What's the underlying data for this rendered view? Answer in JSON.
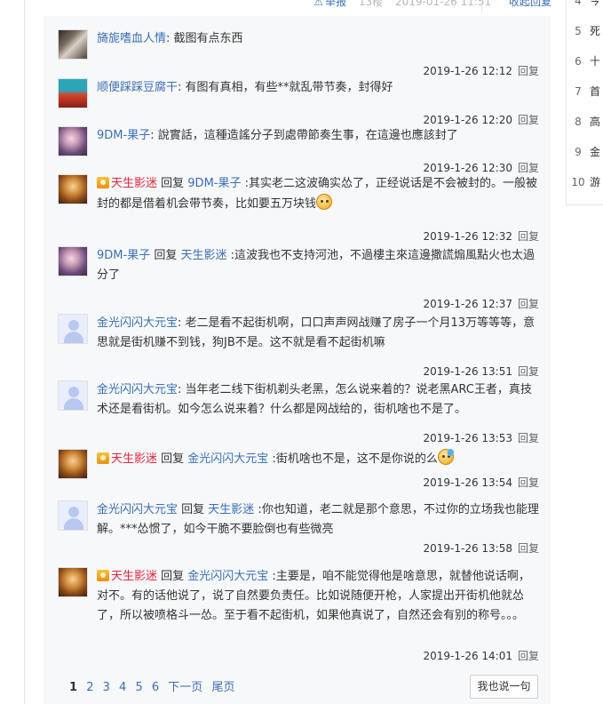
{
  "topbar": {
    "report_label": "举报",
    "floor": "13楼",
    "time": "2019-01-26 11:51",
    "collapse_label": "收起回复"
  },
  "replies": [
    {
      "author": "旖旎嗜血人情",
      "author_color": "#3a6fb4",
      "medal": false,
      "reply_to": "",
      "text": "截图有点东西",
      "time": "2019-1-26 12:12",
      "reply_label": "回复",
      "avatar": "av-1"
    },
    {
      "author": "顺便踩踩豆腐干",
      "author_color": "#3a6fb4",
      "medal": false,
      "reply_to": "",
      "text": "有图有真相，有些**就乱带节奏，封得好",
      "time": "2019-1-26 12:20",
      "reply_label": "回复",
      "avatar": "av-2"
    },
    {
      "author": "9DM-果子",
      "author_color": "#3a6fb4",
      "medal": false,
      "reply_to": "",
      "text": "說實話，這種造謠分子到處帶節奏生事，在這邊也應該封了",
      "time": "2019-1-26 12:30",
      "reply_label": "回复",
      "avatar": "av-3"
    },
    {
      "author": "天生影迷",
      "author_color": "#e0283c",
      "medal": true,
      "reply_to": "9DM-果子",
      "text": "其实老二这波确实怂了，正经说话是不会被封的。一般被封的都是借着机会带节奏，比如要五万块钱",
      "emoji": "smile",
      "time": "2019-1-26 12:32",
      "reply_label": "回复",
      "avatar": "av-4"
    },
    {
      "author": "9DM-果子",
      "author_color": "#3a6fb4",
      "medal": false,
      "reply_to": "天生影迷",
      "text": "這波我也不支持河池，不過樓主來這邊撒謊煽風點火也太過分了",
      "time": "2019-1-26 12:37",
      "reply_label": "回复",
      "avatar": "av-3"
    },
    {
      "author": "金光闪闪大元宝",
      "author_color": "#3a6fb4",
      "medal": false,
      "reply_to": "",
      "text": "老二是看不起街机啊，口口声声网战赚了房子一个月13万等等等，意思就是街机赚不到钱，狗JB不是。这不就是看不起街机嘛",
      "time": "2019-1-26 13:51",
      "reply_label": "回复",
      "avatar": "av-default"
    },
    {
      "author": "金光闪闪大元宝",
      "author_color": "#3a6fb4",
      "medal": false,
      "reply_to": "",
      "text": "当年老二线下街机剃头老黑，怎么说来着的？说老黑ARC王者，真技术还是看街机。如今怎么说来着？什么都是网战给的，街机啥也不是了。",
      "time": "2019-1-26 13:53",
      "reply_label": "回复",
      "avatar": "av-default"
    },
    {
      "author": "天生影迷",
      "author_color": "#e0283c",
      "medal": true,
      "reply_to": "金光闪闪大元宝",
      "text": "街机啥也不是，这不是你说的么",
      "emoji": "sweat",
      "time": "2019-1-26 13:54",
      "reply_label": "回复",
      "avatar": "av-4"
    },
    {
      "author": "金光闪闪大元宝",
      "author_color": "#3a6fb4",
      "medal": false,
      "reply_to": "天生影迷",
      "text": "你也知道，老二就是那个意思，不过你的立场我也能理解。***怂惯了，如今干脆不要脸倒也有些微亮",
      "time": "2019-1-26 13:58",
      "reply_label": "回复",
      "avatar": "av-default"
    },
    {
      "author": "天生影迷",
      "author_color": "#e0283c",
      "medal": true,
      "reply_to": "金光闪闪大元宝",
      "text": "主要是，咱不能觉得他是啥意思，就替他说话啊，对不。有的话他说了，说了自然要负责任。比如说随便开枪，人家提出开街机他就怂了，所以被喷格斗一怂。至于看不起街机，如果他真说了，自然还会有别的称号。。。",
      "time": "2019-1-26 14:01",
      "reply_label": "回复",
      "avatar": "av-4"
    }
  ],
  "reply_word": "回复",
  "pager": {
    "current": "1",
    "pages": [
      "2",
      "3",
      "4",
      "5",
      "6"
    ],
    "next_label": "下一页",
    "last_label": "尾页"
  },
  "say_button_label": "我也说一句",
  "right_rank": [
    {
      "num": "4",
      "text": "今"
    },
    {
      "num": "5",
      "text": "死"
    },
    {
      "num": "6",
      "text": "十"
    },
    {
      "num": "7",
      "text": "首"
    },
    {
      "num": "8",
      "text": "高"
    },
    {
      "num": "9",
      "text": "金"
    },
    {
      "num": "10",
      "text": "游"
    }
  ]
}
